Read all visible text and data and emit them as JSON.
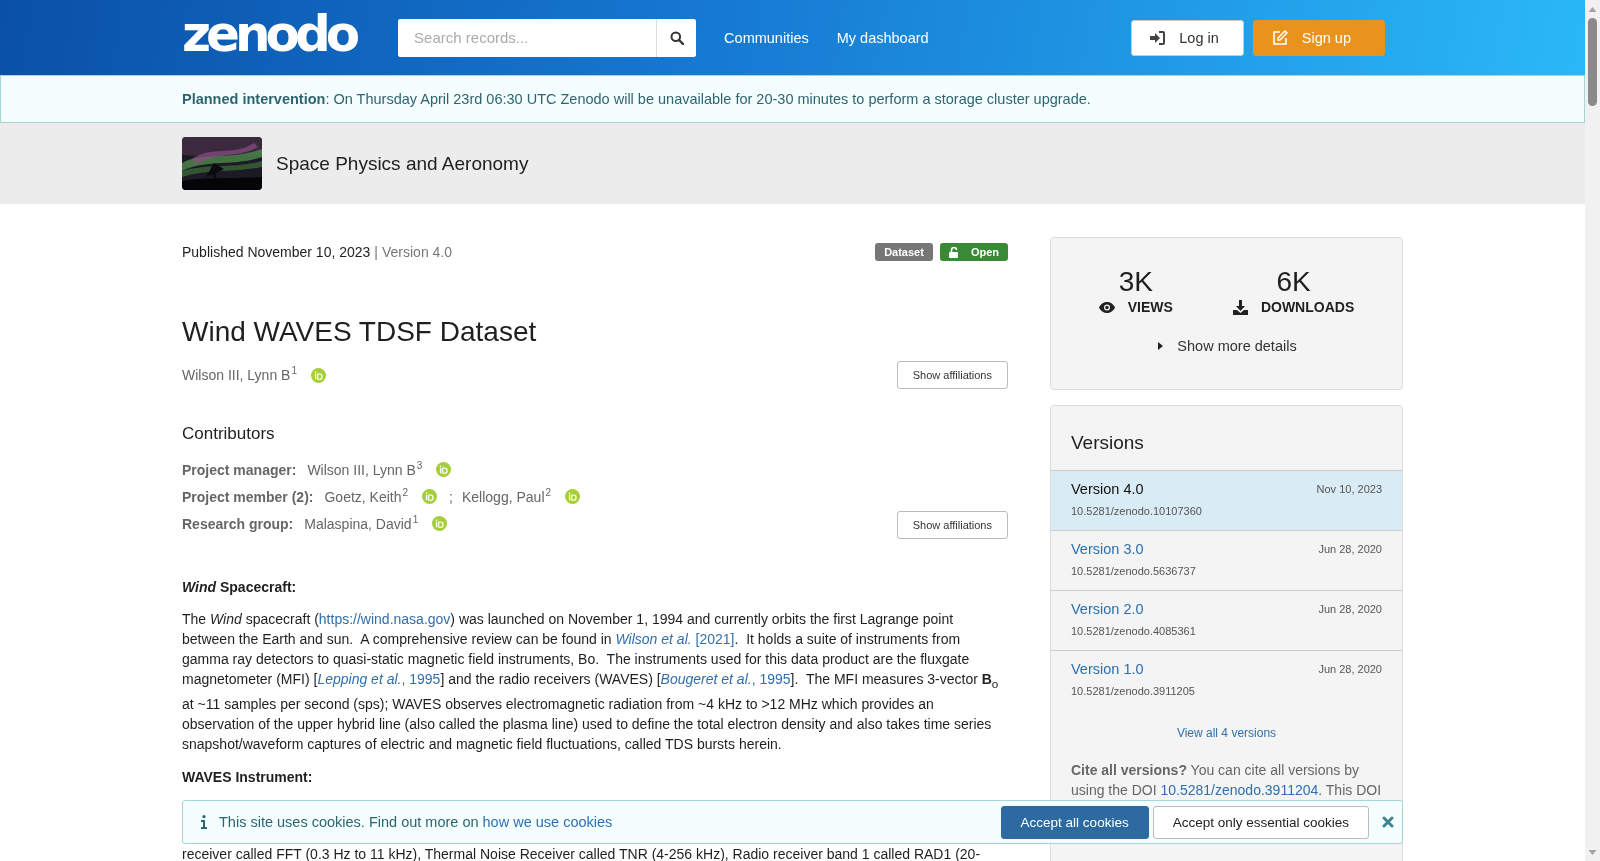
{
  "header": {
    "logo": "zenodo",
    "search": {
      "placeholder": "Search records..."
    },
    "nav": [
      "Communities",
      "My dashboard"
    ],
    "buttons": [
      {
        "kind": "login",
        "label": "Log in"
      },
      {
        "kind": "signup",
        "label": "Sign up"
      }
    ]
  },
  "notice": "**Planned intervention**: On Thursday April 23rd 06:30 UTC Zenodo will be unavailable for 20-30 minutes to perform a storage cluster upgrade.",
  "community": {
    "name": "Space Physics and Aeronomy"
  },
  "record": {
    "published": "Published November 10, 2023",
    "separator": "|",
    "version": "Version 4.0",
    "badges": [
      {
        "kind": "type",
        "label": "Dataset"
      },
      {
        "kind": "access",
        "label": "Open"
      }
    ],
    "title": "Wind WAVES TDSF Dataset",
    "creators": [
      {
        "name": "Wilson III, Lynn B",
        "affiliation": "1"
      }
    ],
    "affiliations_button": "Show affiliations",
    "contributors_heading": "Contributors",
    "contributors": [
      {
        "role": "Project manager:",
        "people": [
          {
            "name": "Wilson III, Lynn B",
            "affiliation": "3"
          }
        ]
      },
      {
        "role": "Project member (2):",
        "people": [
          {
            "name": "Goetz, Keith",
            "affiliation": "2",
            "trailing": ";"
          },
          {
            "name": "Kellogg, Paul",
            "affiliation": "2"
          }
        ]
      },
      {
        "role": "Research group:",
        "people": [
          {
            "name": "Malaspina, David",
            "affiliation": "1"
          }
        ]
      }
    ],
    "contributors_button": "Show affiliations"
  },
  "description": [
    {
      "kind": "heading",
      "text": "*Wind* Spacecraft:"
    },
    {
      "kind": "paragraph",
      "segments": [
        {
          "kind": "text",
          "text": "The *Wind* spacecraft ("
        },
        {
          "kind": "link",
          "text": "https://wind.nasa.gov"
        },
        {
          "kind": "text",
          "text": ") was launched on November 1, 1994 and currently orbits the first Lagrange point between the Earth and sun.  A comprehensive review can be found in "
        },
        {
          "kind": "link",
          "text": "*Wilson et al.* [2021]"
        },
        {
          "kind": "text",
          "text": ".  It holds a suite of instruments from gamma ray detectors to quasi-static magnetic field instruments, Bo.  The instruments used for this data product are the fluxgate magnetometer (MFI) ["
        },
        {
          "kind": "link",
          "text": "*Lepping et al.*, 1995"
        },
        {
          "kind": "text",
          "text": "] and the radio receivers (WAVES) ["
        },
        {
          "kind": "link",
          "text": "*Bougeret et al.*, 1995"
        },
        {
          "kind": "text",
          "text": "].  The MFI measures 3-vector **B**$_{o}$ at ~11 samples per second (sps); WAVES observes electromagnetic radiation from ~4 kHz to >12 MHz which provides an observation of the upper hybrid line (also called the plasma line) used to define the total electron density and also takes time series snapshot/waveform captures of electric and magnetic field fluctuations, called TDS bursts herein."
        }
      ]
    },
    {
      "kind": "heading",
      "text": "WAVES Instrument:"
    },
    {
      "kind": "continued",
      "segments": [
        {
          "kind": "text",
          "text": "receiver called FFT (0.3 Hz to 11 kHz), Thermal Noise Receiver called TNR (4-256 kHz), Radio receiver band 1 called RAD1 (20-"
        }
      ]
    }
  ],
  "stats": [
    {
      "kind": "views",
      "value": "3K",
      "label": "VIEWS"
    },
    {
      "kind": "downloads",
      "value": "6K",
      "label": "DOWNLOADS"
    }
  ],
  "details_toggle": {
    "label": "Show more details",
    "expanded": false
  },
  "versions": {
    "title": "Versions",
    "items": [
      {
        "label": "Version 4.0",
        "date": "Nov 10, 2023",
        "doi": "10.5281/zenodo.10107360",
        "selected": true
      },
      {
        "label": "Version 3.0",
        "date": "Jun 28, 2020",
        "doi": "10.5281/zenodo.5636737",
        "selected": false
      },
      {
        "label": "Version 2.0",
        "date": "Jun 28, 2020",
        "doi": "10.5281/zenodo.4085361",
        "selected": false
      },
      {
        "label": "Version 1.0",
        "date": "Jun 28, 2020",
        "doi": "10.5281/zenodo.3911205",
        "selected": false
      }
    ],
    "view_all": "View all 4 versions",
    "cite": {
      "lead": "Cite all versions?",
      "text": "You can cite all versions by using the DOI",
      "link": "10.5281/zenodo.3911204",
      "tail": ". This DOI"
    }
  },
  "cookies": {
    "text": "This site uses cookies. Find out more on",
    "link": "how we use cookies",
    "buttons": [
      {
        "kind": "primary",
        "label": "Accept all cookies"
      },
      {
        "kind": "secondary",
        "label": "Accept only essential cookies"
      }
    ]
  }
}
